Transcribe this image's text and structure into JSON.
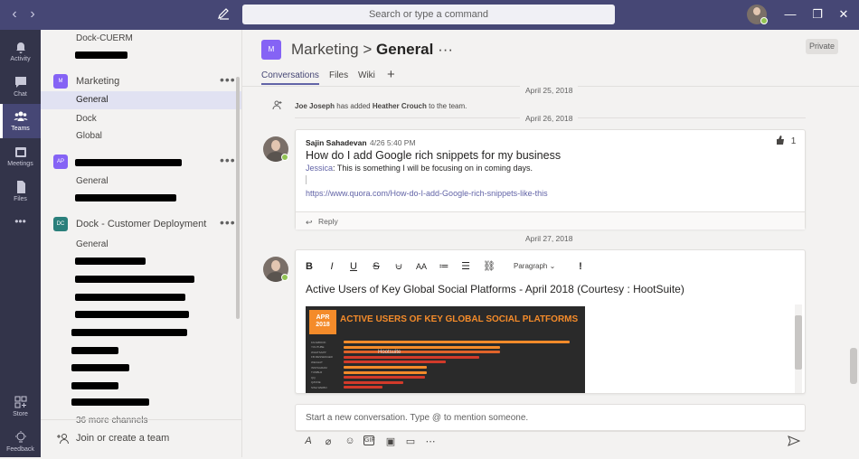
{
  "titlebar": {
    "search_placeholder": "Search or type a command",
    "back_label": "‹",
    "forward_label": "›",
    "minimize_label": "—",
    "maximize_label": "❐",
    "close_label": "✕"
  },
  "rail": {
    "items": [
      {
        "label": "Activity",
        "icon": "bell-icon"
      },
      {
        "label": "Chat",
        "icon": "chat-icon"
      },
      {
        "label": "Teams",
        "icon": "teams-icon",
        "active": true
      },
      {
        "label": "Meetings",
        "icon": "calendar-icon"
      },
      {
        "label": "Files",
        "icon": "file-icon"
      },
      {
        "label": "",
        "icon": "more-icon"
      }
    ],
    "store_label": "Store",
    "feedback_label": "Feedback",
    "more_label": "•••"
  },
  "sidebar": {
    "top_channel": "Dock-CUERM",
    "teams": [
      {
        "name": "Marketing",
        "abbr": "M",
        "color": "#8563f5",
        "channels": [
          "General",
          "Dock",
          "Global"
        ]
      },
      {
        "name": "",
        "abbr": "AP",
        "color": "#8563f5",
        "channels": [
          "General"
        ]
      },
      {
        "name": "Dock - Customer Deployment",
        "abbr": "DC",
        "color": "#2a7f7b",
        "channels": [
          "General"
        ]
      }
    ],
    "more_channels": "36 more channels",
    "team_more": "•••",
    "join_label": "Join or create a team"
  },
  "main": {
    "team_abbr": "M",
    "team_name": "Marketing",
    "separator": ">",
    "channel_name": "General",
    "more": "···",
    "private_label": "Private",
    "tabs": [
      "Conversations",
      "Files",
      "Wiki"
    ],
    "add_tab": "+",
    "dates": [
      "April 25, 2018",
      "April 26, 2018",
      "April 27, 2018"
    ],
    "system_message": {
      "actor": "Joe Joseph",
      "action": "has added",
      "target": "Heather Crouch",
      "suffix": "to the team."
    },
    "post1": {
      "author": "Sajin Sahadevan",
      "time": "4/26 5:40 PM",
      "likes": "1",
      "subject": "How do I add Google rich snippets for my business",
      "mention": "Jessica",
      "body": ": This is something I will be focusing on in coming days.",
      "link": "https://www.quora.com/How-do-I-add-Google-rich-snippets-like-this",
      "reply_label": "Reply"
    },
    "post2": {
      "title": "Active Users of Key Global Social Platforms - April 2018 (Courtesy : HootSuite)",
      "paragraph_label": "Paragraph",
      "image": {
        "badge_month": "APR",
        "badge_year": "2018",
        "headline": "ACTIVE USERS OF KEY GLOBAL SOCIAL PLATFORMS",
        "watermark": "Hootsuite",
        "bars": [
          {
            "label": "FACEBOOK",
            "value": 2167,
            "color": "#f48b2a"
          },
          {
            "label": "YOUTUBE",
            "value": 1500,
            "color": "#f48b2a"
          },
          {
            "label": "WHATSAPP",
            "value": 1500,
            "color": "#e0632a"
          },
          {
            "label": "FB MESSENGER",
            "value": 1300,
            "color": "#d23a2a"
          },
          {
            "label": "WECHAT",
            "value": 980,
            "color": "#d23a2a"
          },
          {
            "label": "INSTAGRAM",
            "value": 800,
            "color": "#f48b2a"
          },
          {
            "label": "TUMBLR",
            "value": 794,
            "color": "#f48b2a"
          },
          {
            "label": "QQ",
            "value": 783,
            "color": "#d23a2a"
          },
          {
            "label": "QZONE",
            "value": 568,
            "color": "#d23a2a"
          },
          {
            "label": "SINA WEIBO",
            "value": 376,
            "color": "#d23a2a"
          }
        ]
      }
    },
    "compose_placeholder": "Start a new conversation. Type @ to mention someone."
  },
  "colors": {
    "brand": "#464775",
    "accent": "#6264a7",
    "rail": "#33344a",
    "presence": "#92c353"
  }
}
